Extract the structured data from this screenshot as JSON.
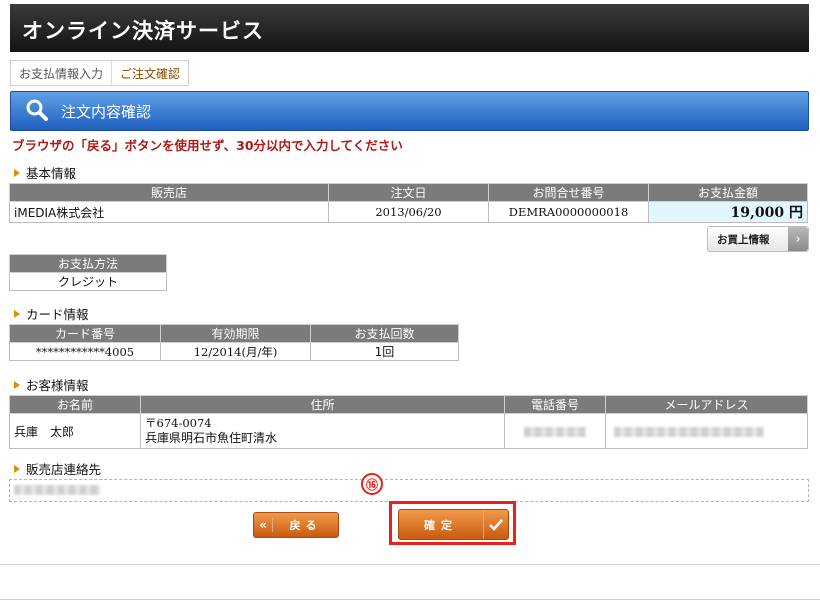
{
  "header": {
    "title": "オンライン決済サービス"
  },
  "breadcrumb": {
    "step1": "お支払情報入力",
    "step2": "ご注文確認"
  },
  "section_bar": {
    "title": "注文内容確認"
  },
  "warning": "ブラウザの「戻る」ボタンを使用せず、30分以内で入力してください",
  "basic": {
    "heading": "基本情報",
    "headers": [
      "販売店",
      "注文日",
      "お問合せ番号",
      "お支払金額"
    ],
    "shop": "iMEDIA株式会社",
    "date": "2013/06/20",
    "inquiry": "DEMRA0000000018",
    "amount": "19,000",
    "yen": "円"
  },
  "purchase_info_button": "お買上情報",
  "payment": {
    "header": "お支払方法",
    "value": "クレジット"
  },
  "card": {
    "heading": "カード情報",
    "headers": [
      "カード番号",
      "有効期限",
      "お支払回数"
    ],
    "number": "************4005",
    "expiry": "12/2014(月/年)",
    "installments": "1回"
  },
  "customer": {
    "heading": "お客様情報",
    "headers": [
      "お名前",
      "住所",
      "電話番号",
      "メールアドレス"
    ],
    "name": "兵庫　太郎",
    "postal": "〒674-0074",
    "address": "兵庫県明石市魚住町清水"
  },
  "shop_contact": {
    "heading": "販売店連絡先"
  },
  "buttons": {
    "back": "戻る",
    "confirm": "確定"
  },
  "step_badge": "⑯",
  "colors": {
    "accent_orange": "#d8691a",
    "highlight": "#e8211b",
    "header_bar": "#2f6fd0"
  }
}
